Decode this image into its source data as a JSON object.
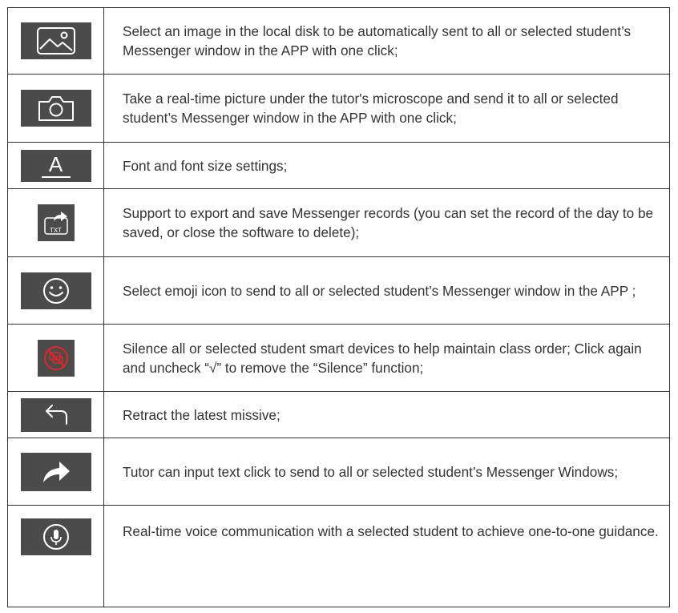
{
  "rows": [
    {
      "icon": "image-icon",
      "text": "Select an image in the local disk to be automatically sent to all or selected student’s Messenger window in the APP with one click;"
    },
    {
      "icon": "camera-icon",
      "text": "Take a real-time picture under the tutor's microscope and send it to all or selected student’s Messenger window in the APP with one click;"
    },
    {
      "icon": "font-icon",
      "text": "Font and font size settings;"
    },
    {
      "icon": "export-txt-icon",
      "text": "Support to export and save Messenger records (you can set the record of the day to be saved, or close the software to delete);"
    },
    {
      "icon": "emoji-icon",
      "text": "Select emoji icon to send to all or selected student’s Messenger window in the APP ;"
    },
    {
      "icon": "silence-icon",
      "text": "Silence all or selected student smart devices to help maintain class order; Click again and uncheck “√” to remove the “Silence” function;"
    },
    {
      "icon": "retract-icon",
      "text": "Retract the latest missive;"
    },
    {
      "icon": "send-icon",
      "text": "Tutor can input text click to send to all or selected student’s Messenger Windows;"
    },
    {
      "icon": "microphone-icon",
      "text": "Real-time voice communication with a selected student to achieve one-to-one guidance."
    }
  ],
  "icon_labels": {
    "font_letter": "A",
    "export_txt": "TXT"
  },
  "colors": {
    "icon_bg": "#4b4b4b",
    "border": "#333333",
    "text": "#333333",
    "silence_red": "#e0262a"
  }
}
